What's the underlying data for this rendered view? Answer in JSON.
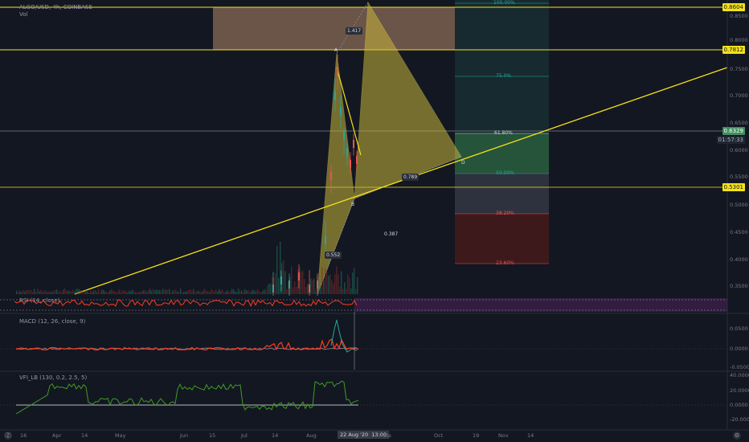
{
  "header": {
    "symbol_line": "ALGO/USD, 4h, COINBASE",
    "vol_label": "Vol"
  },
  "price_axis": {
    "labels": [
      "0.8000",
      "0.7500",
      "0.7000",
      "0.6500",
      "0.6000",
      "0.5500",
      "0.5000",
      "0.4500",
      "0.4000",
      "0.3500"
    ],
    "top_partial": "0.8500",
    "badge_top": "0.8604",
    "badge_2": "0.7812",
    "badge_current": "0.6329",
    "badge_countdown": "01:57:33",
    "badge_low": "0.5301"
  },
  "pattern_labels": {
    "ratio_xa": "1.417",
    "point_a": "A",
    "point_b": "B",
    "point_d": "D",
    "ratio_bc": "0.789",
    "ratio_ab": "0.552",
    "ratio_bd": "0.387"
  },
  "fib_levels": [
    {
      "label": "100.00%",
      "color": "#26a69a"
    },
    {
      "label": "75.0%",
      "color": "#26a69a"
    },
    {
      "label": "61.80%",
      "color": "#d1d4dc"
    },
    {
      "label": "50.00%",
      "color": "#26a69a"
    },
    {
      "label": "38.20%",
      "color": "#ef5350"
    },
    {
      "label": "23.60%",
      "color": "#ef5350"
    }
  ],
  "rsi_panel": {
    "label": "RSI (14, close)"
  },
  "macd_panel": {
    "label": "MACD (12, 26, close, 9)",
    "axis": [
      "0.0500",
      "0.0000",
      "-0.0500"
    ]
  },
  "vfi_panel": {
    "label": "VFI_LB (130, 0.2, 2.5, 5)",
    "axis": [
      "40.0000",
      "20.0000",
      "0.0000",
      "-20.0000"
    ]
  },
  "time_axis": {
    "labels": [
      "16",
      "Apr",
      "14",
      "May",
      "Jun",
      "15",
      "Jul",
      "14",
      "Aug",
      "Oct",
      "19",
      "Nov",
      "14"
    ],
    "crosshair_date": "22 Aug '20",
    "crosshair_time": "13:00",
    "partial_label": "ms"
  },
  "corner_buttons": {
    "left": "Ⓩ",
    "right": "⚙"
  },
  "colors": {
    "background": "#131722",
    "yellow": "#f5e21a",
    "harmonic_fill": "#c8b63a",
    "rsi_line": "#ff3b1f",
    "macd_line": "#ff3b1f",
    "vfi_line": "#3f9b1f",
    "supply_zone": "#8a6a55"
  }
}
